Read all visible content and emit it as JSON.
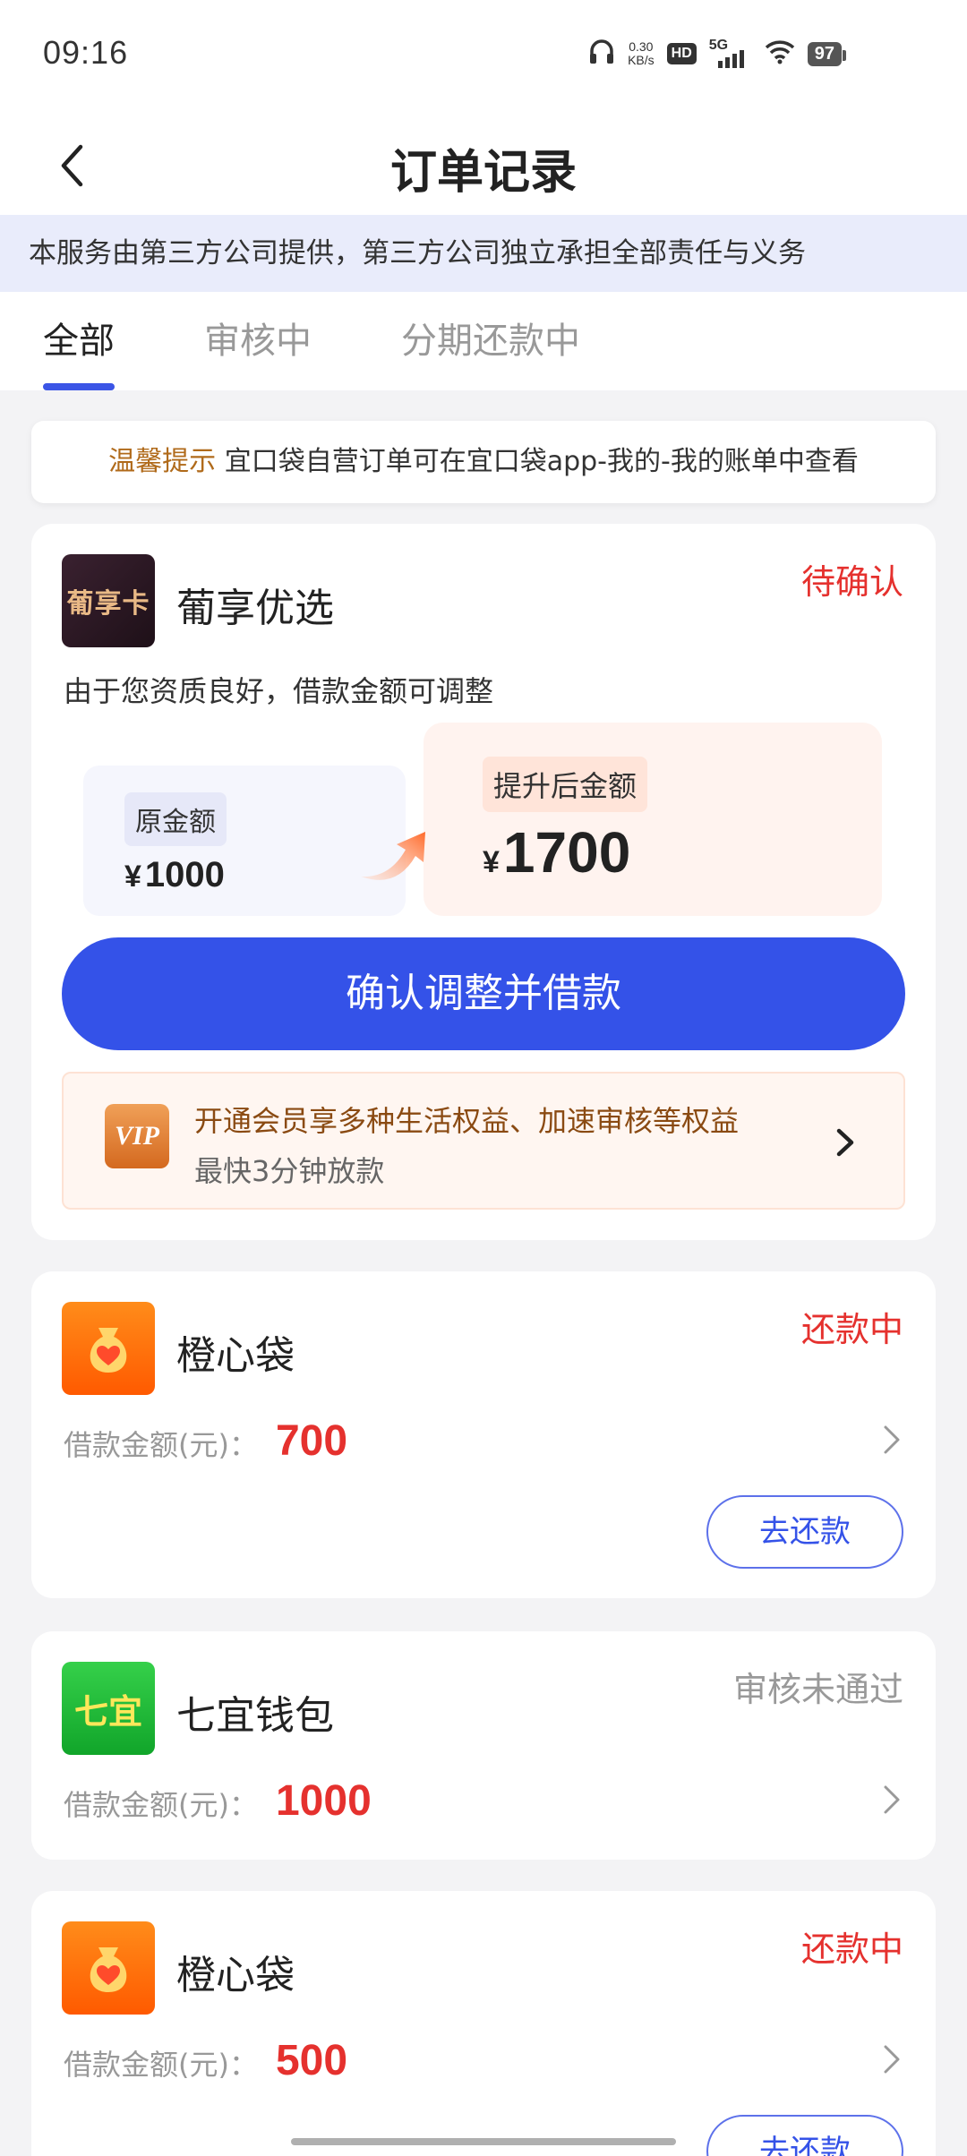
{
  "status_bar": {
    "time": "09:16",
    "net_speed_value": "0.30",
    "net_speed_unit": "KB/s",
    "hd": "HD",
    "network": "5G",
    "battery": "97"
  },
  "header": {
    "title": "订单记录"
  },
  "notice": "本服务由第三方公司提供，第三方公司独立承担全部责任与义务",
  "tabs": [
    {
      "label": "全部",
      "active": true
    },
    {
      "label": "审核中",
      "active": false
    },
    {
      "label": "分期还款中",
      "active": false
    }
  ],
  "tip": {
    "label": "温馨提示",
    "text": "宜口袋自营订单可在宜口袋app-我的-我的账单中查看"
  },
  "orders": [
    {
      "logo_text": "葡享卡",
      "name": "葡享优选",
      "status": "待确认",
      "description": "由于您资质良好，借款金额可调整",
      "original_label": "原金额",
      "original_currency": "¥",
      "original_amount": "1000",
      "upgraded_label": "提升后金额",
      "upgraded_currency": "¥",
      "upgraded_amount": "1700",
      "confirm_button": "确认调整并借款",
      "vip": {
        "icon_text": "VIP",
        "title": "开通会员享多种生活权益、加速审核等权益",
        "subtitle": "最快3分钟放款"
      }
    },
    {
      "name": "橙心袋",
      "status": "还款中",
      "loan_label": "借款金额(元)：",
      "loan_amount": "700",
      "action_button": "去还款"
    },
    {
      "logo_text": "七宜",
      "name": "七宜钱包",
      "status": "审核未通过",
      "loan_label": "借款金额(元)：",
      "loan_amount": "1000"
    },
    {
      "name": "橙心袋",
      "status": "还款中",
      "loan_label": "借款金额(元)：",
      "loan_amount": "500",
      "action_button": "去还款"
    }
  ],
  "colors": {
    "accent_blue": "#3452e8",
    "status_red": "#e5312e",
    "status_gray": "#999999",
    "notice_bg": "#e9ecfb",
    "tip_label_brown": "#b06a1a"
  }
}
